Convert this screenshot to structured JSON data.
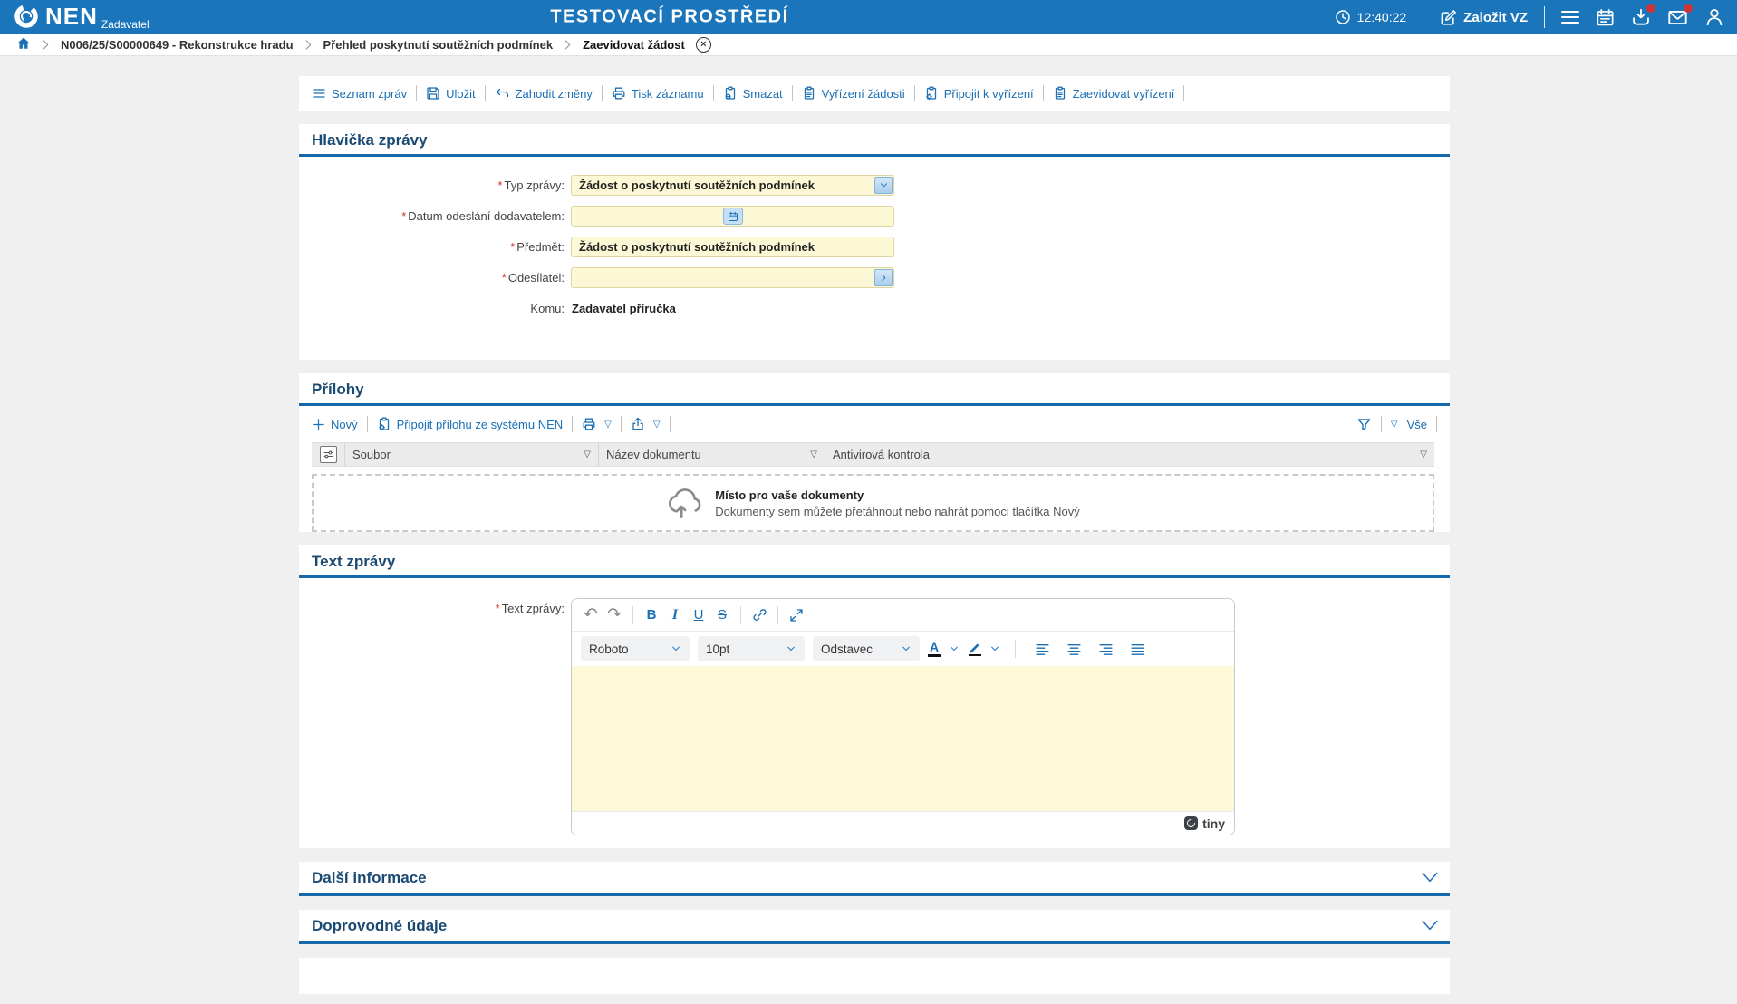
{
  "header": {
    "brand": {
      "name": "NEN",
      "subtitle": "Zadavatel"
    },
    "environment_title": "TESTOVACÍ PROSTŘEDÍ",
    "time": "12:40:22",
    "new_vz_label": "Založit VZ"
  },
  "breadcrumb": {
    "items": [
      {
        "label": "N006/25/S00000649 - Rekonstrukce hradu"
      },
      {
        "label": "Přehled poskytnutí soutěžních podmínek"
      },
      {
        "label": "Zaevidovat žádost"
      }
    ]
  },
  "actions": {
    "items": [
      {
        "label": "Seznam zpráv"
      },
      {
        "label": "Uložit"
      },
      {
        "label": "Zahodit změny"
      },
      {
        "label": "Tisk záznamu"
      },
      {
        "label": "Smazat"
      },
      {
        "label": "Vyřízení žádosti"
      },
      {
        "label": "Připojit k vyřízení"
      },
      {
        "label": "Zaevidovat vyřízení"
      }
    ]
  },
  "hlavicka": {
    "title": "Hlavička zprávy",
    "typ_zpravy_label": "Typ zprávy:",
    "typ_zpravy_value": "Žádost o poskytnutí soutěžních podmínek",
    "datum_label": "Datum odeslání dodavatelem:",
    "datum_value": "",
    "predmet_label": "Předmět:",
    "predmet_value": "Žádost o poskytnutí soutěžních podmínek",
    "odesilatel_label": "Odesílatel:",
    "odesilatel_value": "",
    "komu_label": "Komu:",
    "komu_value": "Zadavatel příručka"
  },
  "prilohy": {
    "title": "Přílohy",
    "new_label": "Nový",
    "attach_label": "Připojit přílohu ze systému NEN",
    "all_label": "Vše",
    "columns": [
      {
        "label": "Soubor"
      },
      {
        "label": "Název dokumentu"
      },
      {
        "label": "Antivirová kontrola"
      }
    ],
    "dropzone": {
      "title": "Místo pro vaše dokumenty",
      "hint": "Dokumenty sem můžete přetáhnout nebo nahrát pomoci tlačítka Nový"
    }
  },
  "text_zpravy": {
    "title": "Text zprávy",
    "label": "Text zprávy:",
    "editor": {
      "font_family": "Roboto",
      "font_size": "10pt",
      "block_format": "Odstavec",
      "bold_glyph": "B",
      "italic_glyph": "I",
      "underline_glyph": "U",
      "strike_glyph": "S",
      "forecolor_glyph": "A",
      "brand": "tiny"
    }
  },
  "sections": {
    "dalsi_informace": "Další informace",
    "doprovodne_udaje": "Doprovodné údaje"
  },
  "icons_glyphs": {
    "required": "*",
    "filter_triangle": "▽",
    "undo": "↶",
    "redo": "↷",
    "close": "×"
  },
  "colors": {
    "header_blue": "#1b75bb",
    "accent_blue": "#1a6fb5",
    "title_blue": "#1a4971",
    "rule_blue": "#1568a9",
    "field_yellow": "#fcf8d6",
    "badge_red": "#cf3434"
  }
}
